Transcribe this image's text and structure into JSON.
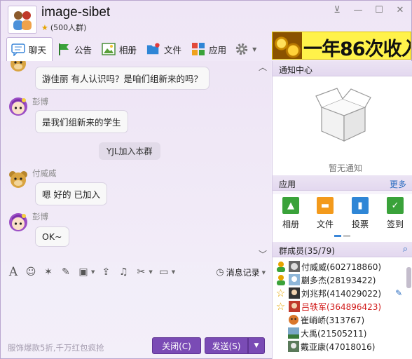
{
  "header": {
    "title": "image-sibet",
    "member_count": "(500人群)"
  },
  "window_controls": [
    "pin",
    "minimize",
    "maximize",
    "close"
  ],
  "tabs": [
    {
      "label": "聊天",
      "icon": "chat-icon"
    },
    {
      "label": "公告",
      "icon": "flag-icon"
    },
    {
      "label": "相册",
      "icon": "photo-icon"
    },
    {
      "label": "文件",
      "icon": "folder-icon"
    },
    {
      "label": "应用",
      "icon": "apps-icon"
    }
  ],
  "banner": {
    "text": "一年86次收入"
  },
  "messages": {
    "m1": {
      "text": "游佳丽 有人认识吗？是咱们组新来的吗？"
    },
    "m2": {
      "name": "彭博",
      "text": "是我们组新来的学生"
    },
    "sys": {
      "text": "YJL加入本群"
    },
    "m3": {
      "name": "付威威",
      "text": "嗯 好的 已加入"
    },
    "m4": {
      "name": "彭博",
      "text": "OK~"
    }
  },
  "input_toolbar": {
    "history_label": "消息记录",
    "icons": [
      "font-icon",
      "emoji-icon",
      "magic-icon",
      "edit-icon",
      "image-icon",
      "upload-icon",
      "music-icon",
      "scissors-icon",
      "screen-icon"
    ]
  },
  "footer": {
    "ad_text": "服饰爆款5折,千万红包疯抢",
    "close_label": "关闭(C)",
    "send_label": "发送(S)"
  },
  "notify": {
    "title": "通知中心",
    "empty_text": "暂无通知"
  },
  "apps": {
    "title": "应用",
    "more": "更多",
    "items": [
      {
        "label": "相册",
        "color": "#3aa23a"
      },
      {
        "label": "文件",
        "color": "#f39a1c"
      },
      {
        "label": "投票",
        "color": "#2f86d6"
      },
      {
        "label": "签到",
        "color": "#3aa23a"
      }
    ]
  },
  "members": {
    "title": "群成员(35/79)",
    "list": [
      {
        "text": "付威威(602718860)",
        "red": false
      },
      {
        "text": "蒯多杰(28193422)",
        "red": false
      },
      {
        "text": "刘兆邦(414029022)",
        "red": false
      },
      {
        "text": "吕轶军(364896423)",
        "red": true
      },
      {
        "text": "崔峭峤(313767)",
        "red": false
      },
      {
        "text": "大禹(21505211)",
        "red": false
      },
      {
        "text": "戴亚康(47018016)",
        "red": false
      }
    ]
  }
}
